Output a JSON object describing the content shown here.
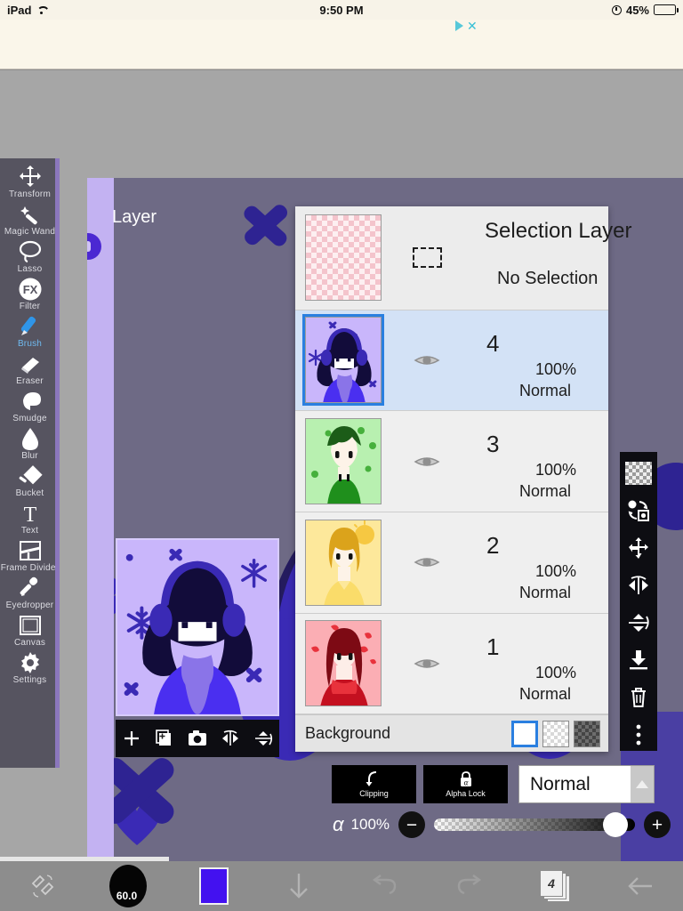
{
  "statusbar": {
    "device": "iPad",
    "wifi_icon": "wifi-icon",
    "time": "9:50 PM",
    "alarm_icon": "alarm-icon",
    "battery_percent": "45%",
    "battery_icon": "battery-icon"
  },
  "ad": {
    "play_icon": "ad-play-icon",
    "close_icon": "ad-close-icon"
  },
  "toolbar": {
    "items": [
      {
        "label": "Transform",
        "icon": "transform-icon",
        "active": false
      },
      {
        "label": "Magic Wand",
        "icon": "magic-wand-icon",
        "active": false
      },
      {
        "label": "Lasso",
        "icon": "lasso-icon",
        "active": false
      },
      {
        "label": "Filter",
        "icon": "filter-fx-icon",
        "active": false
      },
      {
        "label": "Brush",
        "icon": "brush-icon",
        "active": true
      },
      {
        "label": "Eraser",
        "icon": "eraser-icon",
        "active": false
      },
      {
        "label": "Smudge",
        "icon": "smudge-icon",
        "active": false
      },
      {
        "label": "Blur",
        "icon": "blur-droplet-icon",
        "active": false
      },
      {
        "label": "Bucket",
        "icon": "bucket-icon",
        "active": false
      },
      {
        "label": "Text",
        "icon": "text-icon",
        "active": false
      },
      {
        "label": "Frame Divider",
        "icon": "frame-divider-icon",
        "active": false
      },
      {
        "label": "Eyedropper",
        "icon": "eyedropper-icon",
        "active": false
      },
      {
        "label": "Canvas",
        "icon": "canvas-icon",
        "active": false
      },
      {
        "label": "Settings",
        "icon": "gear-icon",
        "active": false
      }
    ]
  },
  "board": {
    "title": "Layer",
    "canvas_color": "#6e6a85",
    "strip_color": "#c3b2f2",
    "handle_icon": "canvas-resize-handle"
  },
  "preview_tools": {
    "items": [
      {
        "icon": "add-layer-icon"
      },
      {
        "icon": "duplicate-layer-icon"
      },
      {
        "icon": "camera-icon"
      },
      {
        "icon": "flip-horizontal-icon"
      },
      {
        "icon": "flip-vertical-icon"
      }
    ]
  },
  "layers_panel": {
    "selection_layer": {
      "title": "Selection Layer",
      "status": "No Selection",
      "thumb_icon": "transparent-checker-thumb",
      "marquee_icon": "selection-marquee-icon"
    },
    "layers": [
      {
        "name": "4",
        "opacity": "100%",
        "blend": "Normal",
        "selected": true,
        "visible": true,
        "eye_icon": "eye-icon"
      },
      {
        "name": "3",
        "opacity": "100%",
        "blend": "Normal",
        "selected": false,
        "visible": true,
        "eye_icon": "eye-icon"
      },
      {
        "name": "2",
        "opacity": "100%",
        "blend": "Normal",
        "selected": false,
        "visible": true,
        "eye_icon": "eye-icon"
      },
      {
        "name": "1",
        "opacity": "100%",
        "blend": "Normal",
        "selected": false,
        "visible": true,
        "eye_icon": "eye-icon"
      }
    ],
    "background": {
      "label": "Background",
      "swatches": [
        {
          "name": "white",
          "selected": true
        },
        {
          "name": "light-checker",
          "selected": false
        },
        {
          "name": "dark-checker",
          "selected": false
        }
      ]
    }
  },
  "layer_actions": {
    "clipping": {
      "label": "Clipping",
      "icon": "clipping-icon"
    },
    "alpha_lock": {
      "label": "Alpha Lock",
      "icon": "alpha-lock-icon"
    },
    "blend_mode": {
      "value": "Normal",
      "arrow_icon": "chevron-up-icon"
    },
    "alpha": {
      "symbol": "α",
      "value": "100%",
      "minus_label": "−",
      "plus_label": "+"
    }
  },
  "right_toolbar": {
    "items": [
      {
        "icon": "transparency-checker-icon"
      },
      {
        "icon": "transform-swap-icon"
      },
      {
        "icon": "move-icon"
      },
      {
        "icon": "flip-horizontal-icon"
      },
      {
        "icon": "flip-vertical-icon"
      },
      {
        "icon": "merge-down-icon"
      },
      {
        "icon": "trash-icon"
      },
      {
        "icon": "more-options-icon"
      }
    ]
  },
  "appbar": {
    "items": [
      {
        "icon": "brush-eraser-toggle-icon",
        "label": ""
      },
      {
        "icon": "brush-size-icon",
        "label": "60.0"
      },
      {
        "icon": "color-swatch-icon",
        "label": "",
        "color": "#4311f0"
      },
      {
        "icon": "download-arrow-icon",
        "label": ""
      },
      {
        "icon": "undo-icon",
        "label": ""
      },
      {
        "icon": "redo-icon",
        "label": ""
      },
      {
        "icon": "layers-icon",
        "label": "4"
      },
      {
        "icon": "back-arrow-icon",
        "label": ""
      }
    ]
  }
}
